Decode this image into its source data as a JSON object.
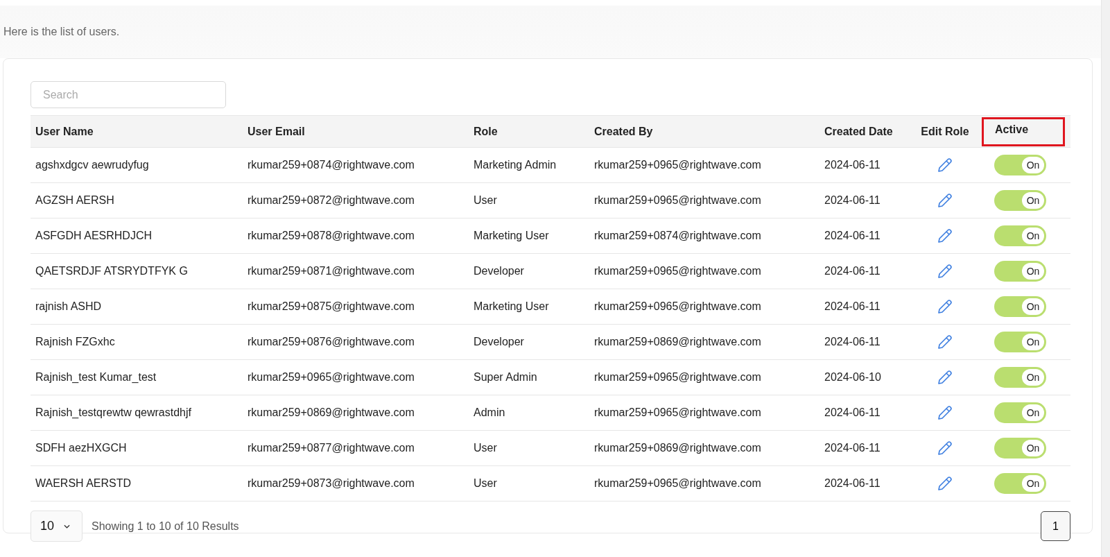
{
  "intro": "Here is the list of users.",
  "search": {
    "placeholder": "Search"
  },
  "columns": [
    {
      "label": "User Name",
      "highlighted": false
    },
    {
      "label": "User Email",
      "highlighted": false
    },
    {
      "label": "Role",
      "highlighted": false
    },
    {
      "label": "Created By",
      "highlighted": false
    },
    {
      "label": "Created Date",
      "highlighted": false
    },
    {
      "label": "Edit Role",
      "highlighted": false
    },
    {
      "label": "Active",
      "highlighted": true
    }
  ],
  "rows": [
    {
      "name": "agshxdgcv aewrudyfug",
      "email": "rkumar259+0874@rightwave.com",
      "role": "Marketing Admin",
      "created_by": "rkumar259+0965@rightwave.com",
      "created_date": "2024-06-11",
      "active": true,
      "active_label": "On"
    },
    {
      "name": "AGZSH AERSH",
      "email": "rkumar259+0872@rightwave.com",
      "role": "User",
      "created_by": "rkumar259+0965@rightwave.com",
      "created_date": "2024-06-11",
      "active": true,
      "active_label": "On"
    },
    {
      "name": "ASFGDH AESRHDJCH",
      "email": "rkumar259+0878@rightwave.com",
      "role": "Marketing User",
      "created_by": "rkumar259+0874@rightwave.com",
      "created_date": "2024-06-11",
      "active": true,
      "active_label": "On"
    },
    {
      "name": "QAETSRDJF ATSRYDTFYK G",
      "email": "rkumar259+0871@rightwave.com",
      "role": "Developer",
      "created_by": "rkumar259+0965@rightwave.com",
      "created_date": "2024-06-11",
      "active": true,
      "active_label": "On"
    },
    {
      "name": "rajnish ASHD",
      "email": "rkumar259+0875@rightwave.com",
      "role": "Marketing User",
      "created_by": "rkumar259+0965@rightwave.com",
      "created_date": "2024-06-11",
      "active": true,
      "active_label": "On"
    },
    {
      "name": "Rajnish FZGxhc",
      "email": "rkumar259+0876@rightwave.com",
      "role": "Developer",
      "created_by": "rkumar259+0869@rightwave.com",
      "created_date": "2024-06-11",
      "active": true,
      "active_label": "On"
    },
    {
      "name": "Rajnish_test Kumar_test",
      "email": "rkumar259+0965@rightwave.com",
      "role": "Super Admin",
      "created_by": "rkumar259+0965@rightwave.com",
      "created_date": "2024-06-10",
      "active": true,
      "active_label": "On"
    },
    {
      "name": "Rajnish_testqrewtw qewrastdhjf",
      "email": "rkumar259+0869@rightwave.com",
      "role": "Admin",
      "created_by": "rkumar259+0965@rightwave.com",
      "created_date": "2024-06-11",
      "active": true,
      "active_label": "On"
    },
    {
      "name": "SDFH aezHXGCH",
      "email": "rkumar259+0877@rightwave.com",
      "role": "User",
      "created_by": "rkumar259+0869@rightwave.com",
      "created_date": "2024-06-11",
      "active": true,
      "active_label": "On"
    },
    {
      "name": "WAERSH AERSTD",
      "email": "rkumar259+0873@rightwave.com",
      "role": "User",
      "created_by": "rkumar259+0965@rightwave.com",
      "created_date": "2024-06-11",
      "active": true,
      "active_label": "On"
    }
  ],
  "page_size": "10",
  "summary": "Showing 1 to 10 of 10 Results",
  "pages": [
    {
      "label": "1",
      "selected": true
    }
  ]
}
